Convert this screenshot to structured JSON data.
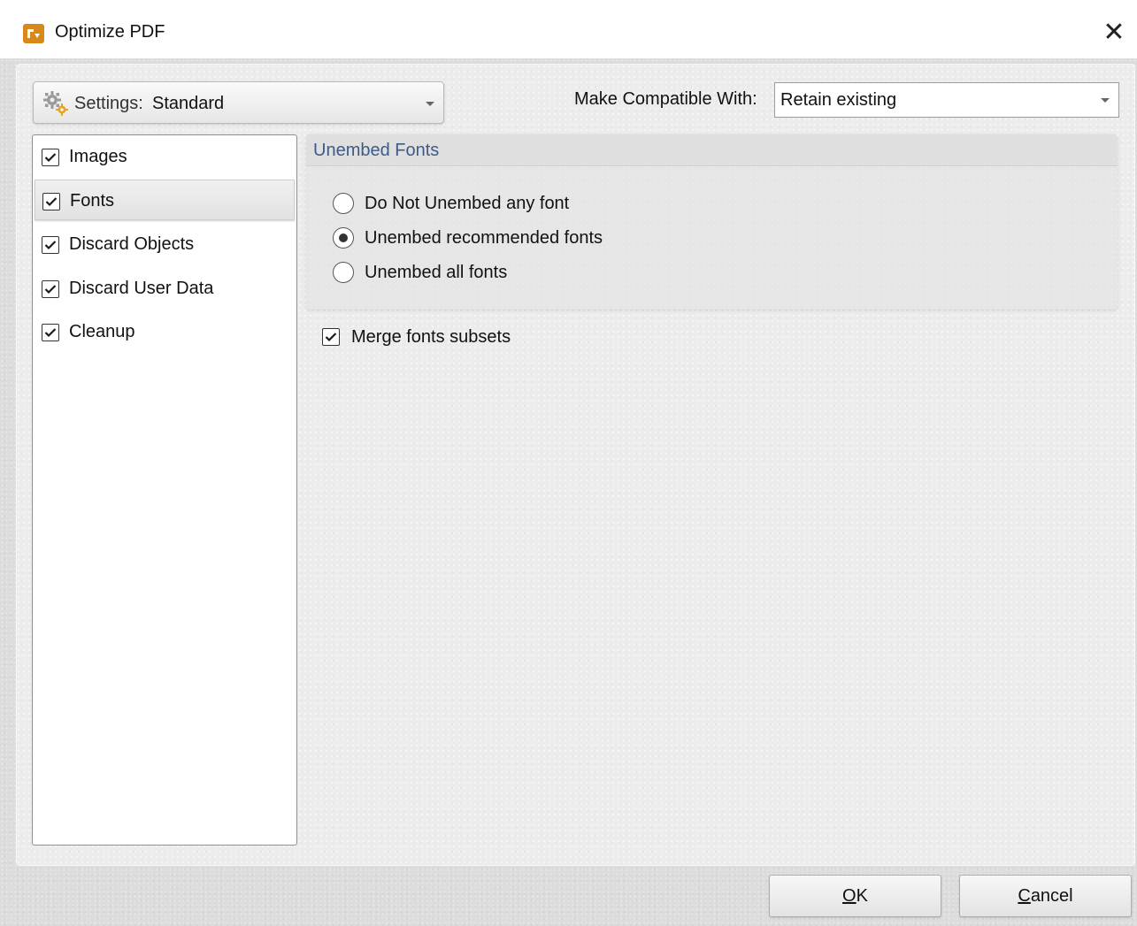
{
  "window": {
    "title": "Optimize PDF",
    "close_glyph": "✕"
  },
  "settings": {
    "label": "Settings:",
    "value": "Standard",
    "icon": "gear-icon"
  },
  "compatibility": {
    "label": "Make Compatible With:",
    "value": "Retain existing"
  },
  "sidebar": {
    "items": [
      {
        "label": "Images",
        "checked": true,
        "selected": false
      },
      {
        "label": "Fonts",
        "checked": true,
        "selected": true
      },
      {
        "label": "Discard Objects",
        "checked": true,
        "selected": false
      },
      {
        "label": "Discard User Data",
        "checked": true,
        "selected": false
      },
      {
        "label": "Cleanup",
        "checked": true,
        "selected": false
      }
    ]
  },
  "unembed_fonts": {
    "title": "Unembed Fonts",
    "options": [
      {
        "label": "Do Not Unembed any font",
        "selected": false
      },
      {
        "label": "Unembed recommended fonts",
        "selected": true
      },
      {
        "label": "Unembed all fonts",
        "selected": false
      }
    ]
  },
  "merge_fonts": {
    "label": "Merge fonts subsets",
    "checked": true
  },
  "buttons": {
    "ok": {
      "accel": "O",
      "rest": "K"
    },
    "cancel": {
      "accel": "C",
      "rest": "ancel"
    }
  },
  "colors": {
    "accent_title": "#3c5b86",
    "app_icon": "#d9881c"
  }
}
